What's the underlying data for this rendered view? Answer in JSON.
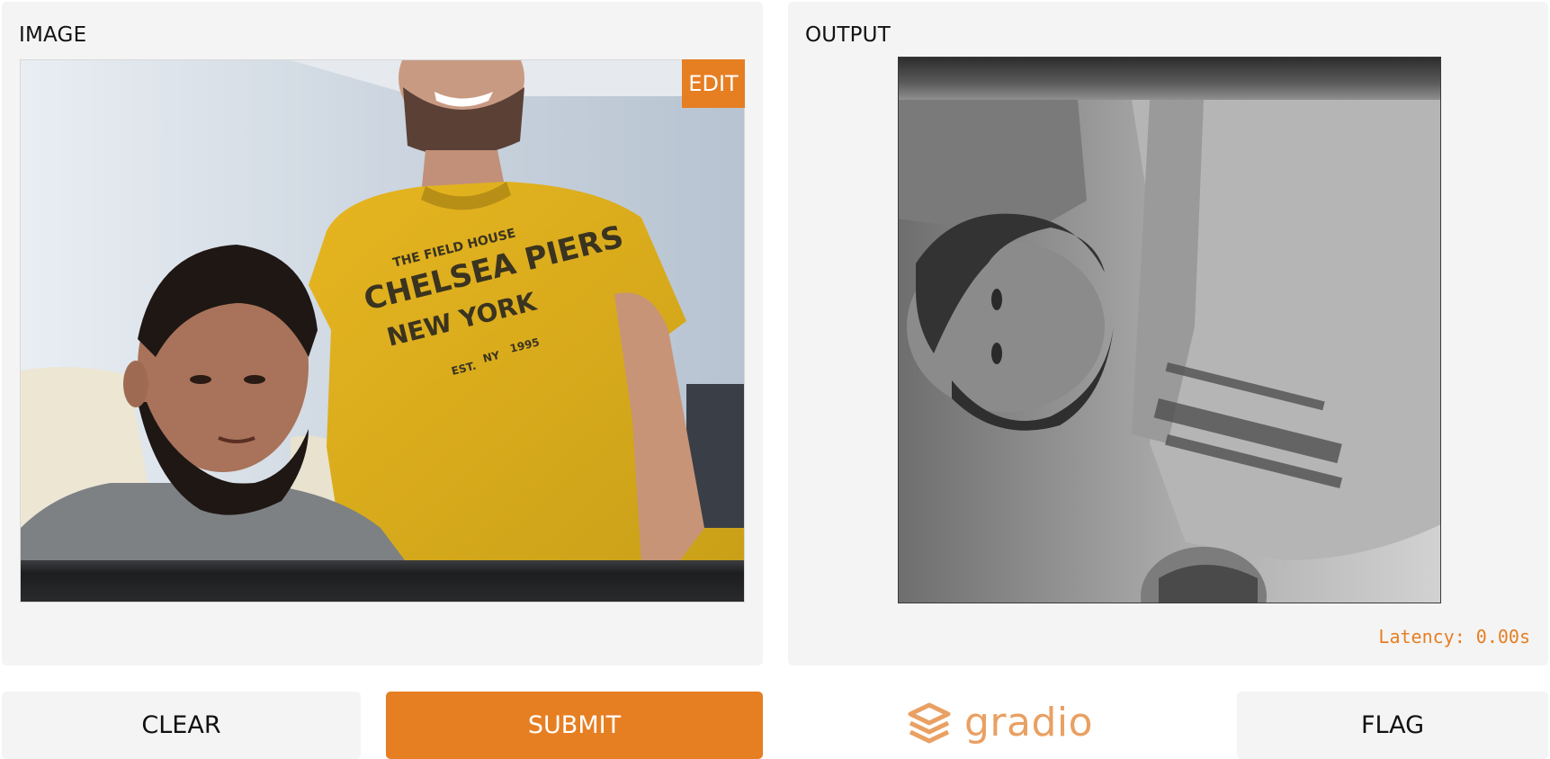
{
  "input": {
    "label": "IMAGE",
    "edit_label": "EDIT",
    "image_alt": "webcam photo of two people, one wearing a yellow CHELSEA PIERS NEW YORK t-shirt"
  },
  "output": {
    "label": "OUTPUT",
    "latency": "Latency: 0.00s"
  },
  "buttons": {
    "clear": "CLEAR",
    "submit": "SUBMIT",
    "flag": "FLAG"
  },
  "brand": {
    "name": "gradio",
    "accent": "#e67e22"
  },
  "shirt": {
    "line1": "THE FIELD HOUSE",
    "line2": "CHELSEA PIERS",
    "line3": "NEW YORK",
    "line4": "EST.",
    "line5": "NY",
    "line6": "1995"
  }
}
